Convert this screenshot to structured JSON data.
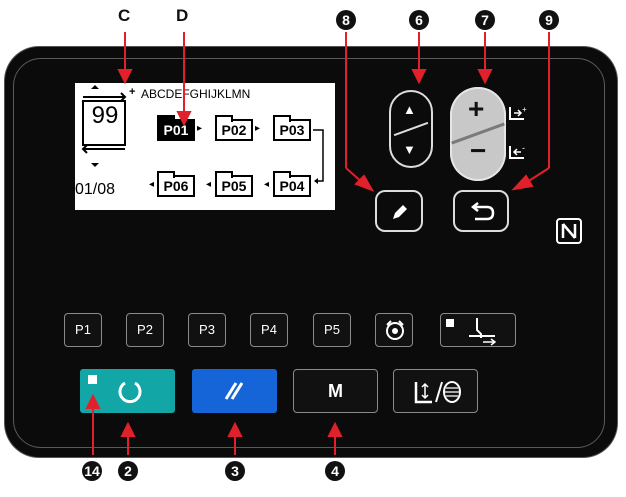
{
  "callouts": {
    "c": "C",
    "d": "D",
    "n8": "8",
    "n6": "6",
    "n7": "7",
    "n9": "9",
    "n14": "14",
    "n2": "2",
    "n3": "3",
    "n4": "4"
  },
  "lcd": {
    "counter": "99",
    "alphabet": "ABCDEFGHIJKLMN",
    "page": "01/08",
    "patterns_top": [
      "P01",
      "P02",
      "P03"
    ],
    "patterns_bottom": [
      "P06",
      "P05",
      "P04"
    ]
  },
  "keys": {
    "p1": "P1",
    "p2": "P2",
    "p3": "P3",
    "p4": "P4",
    "p5": "P5",
    "mode": "M",
    "plus": "+",
    "minus": "−"
  },
  "colors": {
    "ready": "#12a6a6",
    "reset": "#1565d8",
    "arrow": "#e0202a",
    "panel": "#0b0b0b"
  },
  "icons": [
    "up-arrow-icon",
    "down-arrow-icon",
    "pencil-icon",
    "return-icon",
    "nfc-icon",
    "winder-icon",
    "thread-clamp-icon",
    "bobbin-icon",
    "ready-icon",
    "reset-icon"
  ]
}
